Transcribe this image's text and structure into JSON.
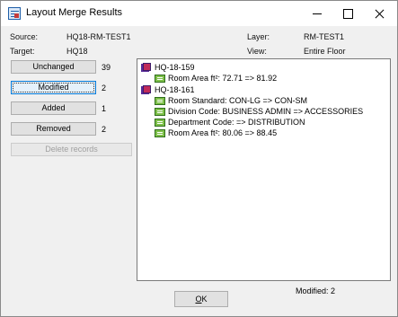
{
  "window": {
    "title": "Layout Merge Results"
  },
  "info": {
    "source_label": "Source:",
    "source_value": "HQ18-RM-TEST1",
    "target_label": "Target:",
    "target_value": "HQ18",
    "layer_label": "Layer:",
    "layer_value": "RM-TEST1",
    "view_label": "View:",
    "view_value": "Entire Floor"
  },
  "categories": [
    {
      "label": "Unchanged",
      "count": "39"
    },
    {
      "label": "Modified",
      "count": "2"
    },
    {
      "label": "Added",
      "count": "1"
    },
    {
      "label": "Removed",
      "count": "2"
    }
  ],
  "delete_records_label": "Delete records",
  "tree": {
    "rooms": [
      {
        "name": "HQ-18-159",
        "fields": [
          "Room Area ft²:  72.71  =>  81.92"
        ]
      },
      {
        "name": "HQ-18-161",
        "fields": [
          "Room Standard:  CON-LG  =>  CON-SM",
          "Division Code:  BUSINESS ADMIN  =>  ACCESSORIES",
          "Department Code:    =>  DISTRIBUTION",
          "Room Area ft²:  80.06  =>  88.45"
        ]
      }
    ]
  },
  "status": {
    "modified_text": "Modified:  2"
  },
  "ok_label": {
    "accel": "O",
    "rest": "K"
  }
}
